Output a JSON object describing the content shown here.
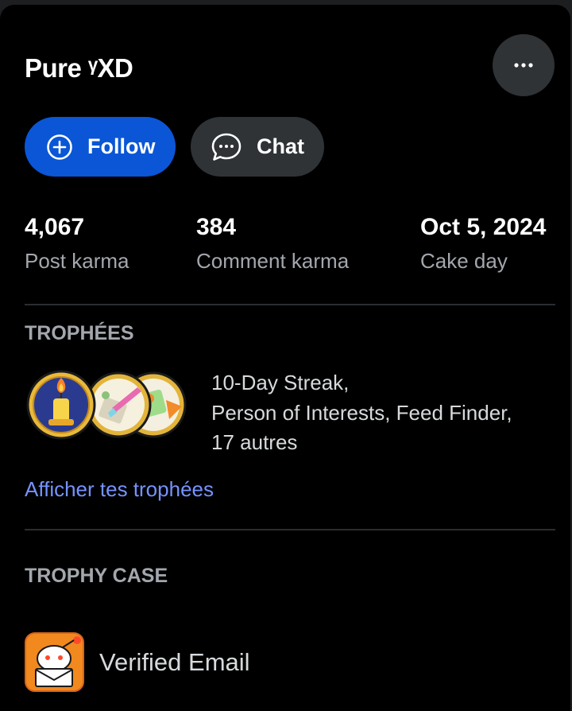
{
  "profile": {
    "username": "Pure     ᵞXD"
  },
  "actions": {
    "more_icon": "ellipsis-horizontal-icon",
    "follow_label": "Follow",
    "follow_icon": "plus-circle-icon",
    "chat_label": "Chat",
    "chat_icon": "chat-bubble-icon",
    "follow_color": "#0a56d6"
  },
  "stats": [
    {
      "value": "4,067",
      "label": "Post karma"
    },
    {
      "value": "384",
      "label": "Comment karma"
    },
    {
      "value": "Oct 5, 2024",
      "label": "Cake day"
    }
  ],
  "trophies": {
    "title": "TROPHÉES",
    "lines": [
      "10-Day Streak,",
      "Person of Interests, Feed Finder,",
      "17 autres"
    ],
    "link": "Afficher tes trophées",
    "icons": [
      "candle-trophy-icon",
      "paintbrush-trophy-icon",
      "map-trophy-icon"
    ]
  },
  "trophy_case": {
    "title": "TROPHY CASE",
    "items": [
      {
        "label": "Verified Email",
        "icon": "verified-email-trophy-icon"
      }
    ]
  }
}
